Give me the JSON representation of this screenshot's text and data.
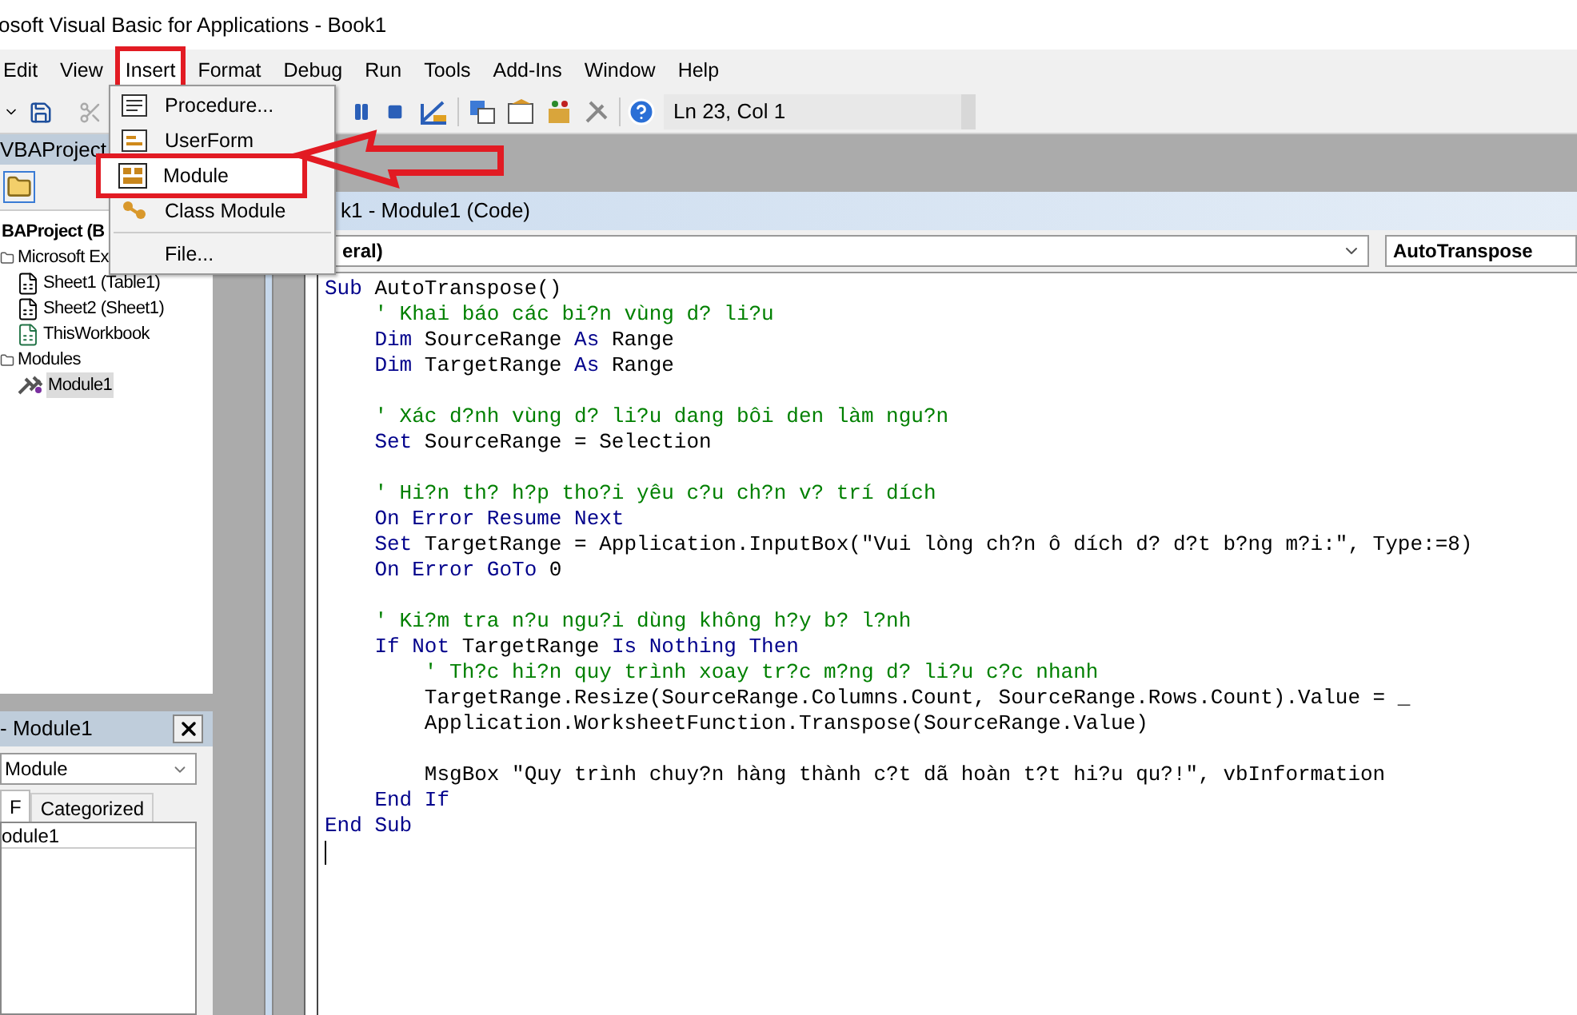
{
  "window": {
    "title": "osoft Visual Basic for Applications - Book1"
  },
  "menu_bar": [
    {
      "label": "Edit",
      "highlighted": false
    },
    {
      "label": "View",
      "highlighted": false
    },
    {
      "label": "Insert",
      "highlighted": true
    },
    {
      "label": "Format",
      "highlighted": false
    },
    {
      "label": "Debug",
      "highlighted": false
    },
    {
      "label": "Run",
      "highlighted": false
    },
    {
      "label": "Tools",
      "highlighted": false
    },
    {
      "label": "Add-Ins",
      "highlighted": false
    },
    {
      "label": "Window",
      "highlighted": false
    },
    {
      "label": "Help",
      "highlighted": false
    }
  ],
  "insert_menu": [
    {
      "label": "Procedure...",
      "kind": "procedure",
      "highlighted": false
    },
    {
      "label": "UserForm",
      "kind": "userform",
      "highlighted": false
    },
    {
      "label": "Module",
      "kind": "module",
      "highlighted": true
    },
    {
      "label": "Class Module",
      "kind": "class",
      "highlighted": false
    },
    {
      "label": "File...",
      "kind": "file",
      "highlighted": false
    }
  ],
  "toolbar": {
    "position": "Ln 23, Col 1"
  },
  "project_explorer": {
    "title": "VBAProject",
    "tree": [
      {
        "label": "BAProject (B",
        "kind": "project",
        "selected": false,
        "children": [
          {
            "label": "Microsoft Ex",
            "kind": "folder",
            "selected": false,
            "children": [
              {
                "label": "Sheet1 (Table1)",
                "kind": "sheet",
                "selected": false
              },
              {
                "label": "Sheet2 (Sheet1)",
                "kind": "sheet",
                "selected": false
              },
              {
                "label": "ThisWorkbook",
                "kind": "workbook",
                "selected": false
              }
            ]
          },
          {
            "label": "Modules",
            "kind": "folder",
            "selected": false,
            "children": [
              {
                "label": "Module1",
                "kind": "module",
                "selected": true
              }
            ]
          }
        ]
      }
    ]
  },
  "properties": {
    "title": "- Module1",
    "object": "Module",
    "tabs": [
      {
        "label": "F",
        "selected": true
      },
      {
        "label": "Categorized",
        "selected": false
      }
    ],
    "rows": [
      "odule1"
    ]
  },
  "code_window": {
    "title": "k1 - Module1 (Code)",
    "object": "eral)",
    "procedure": "AutoTranspose",
    "lines": [
      {
        "kind": "code",
        "segments": [
          {
            "t": "Sub",
            "kind": "keyword"
          },
          {
            "t": " AutoTranspose()",
            "kind": "plain"
          }
        ]
      },
      {
        "kind": "code",
        "segments": [
          {
            "t": "    ' Khai báo các bi?n vùng d? li?u",
            "kind": "comment"
          }
        ]
      },
      {
        "kind": "code",
        "segments": [
          {
            "t": "    Dim",
            "kind": "keyword"
          },
          {
            "t": " SourceRange ",
            "kind": "plain"
          },
          {
            "t": "As",
            "kind": "keyword"
          },
          {
            "t": " Range",
            "kind": "plain"
          }
        ]
      },
      {
        "kind": "code",
        "segments": [
          {
            "t": "    Dim",
            "kind": "keyword"
          },
          {
            "t": " TargetRange ",
            "kind": "plain"
          },
          {
            "t": "As",
            "kind": "keyword"
          },
          {
            "t": " Range",
            "kind": "plain"
          }
        ]
      },
      {
        "kind": "blank"
      },
      {
        "kind": "code",
        "segments": [
          {
            "t": "    ' Xác d?nh vùng d? li?u dang bôi den làm ngu?n",
            "kind": "comment"
          }
        ]
      },
      {
        "kind": "code",
        "segments": [
          {
            "t": "    Set",
            "kind": "keyword"
          },
          {
            "t": " SourceRange = Selection",
            "kind": "plain"
          }
        ]
      },
      {
        "kind": "blank"
      },
      {
        "kind": "code",
        "segments": [
          {
            "t": "    ' Hi?n th? h?p tho?i yêu c?u ch?n v? trí dích",
            "kind": "comment"
          }
        ]
      },
      {
        "kind": "code",
        "segments": [
          {
            "t": "    On Error Resume Next",
            "kind": "keyword"
          }
        ]
      },
      {
        "kind": "code",
        "segments": [
          {
            "t": "    Set",
            "kind": "keyword"
          },
          {
            "t": " TargetRange = Application.InputBox(\"Vui lòng ch?n ô dích d? d?t b?ng m?i:\", Type:=8)",
            "kind": "plain"
          }
        ]
      },
      {
        "kind": "code",
        "segments": [
          {
            "t": "    On Error GoTo",
            "kind": "keyword"
          },
          {
            "t": " 0",
            "kind": "plain"
          }
        ]
      },
      {
        "kind": "blank"
      },
      {
        "kind": "code",
        "segments": [
          {
            "t": "    ' Ki?m tra n?u ngu?i dùng không h?y b? l?nh",
            "kind": "comment"
          }
        ]
      },
      {
        "kind": "code",
        "segments": [
          {
            "t": "    If Not",
            "kind": "keyword"
          },
          {
            "t": " TargetRange ",
            "kind": "plain"
          },
          {
            "t": "Is Nothing Then",
            "kind": "keyword"
          }
        ]
      },
      {
        "kind": "code",
        "segments": [
          {
            "t": "        ' Th?c hi?n quy trình xoay tr?c m?ng d? li?u c?c nhanh",
            "kind": "comment"
          }
        ]
      },
      {
        "kind": "code",
        "segments": [
          {
            "t": "        TargetRange.Resize(SourceRange.Columns.Count, SourceRange.Rows.Count).Value = _",
            "kind": "plain"
          }
        ]
      },
      {
        "kind": "code",
        "segments": [
          {
            "t": "        Application.WorksheetFunction.Transpose(SourceRange.Value)",
            "kind": "plain"
          }
        ]
      },
      {
        "kind": "blank"
      },
      {
        "kind": "code",
        "segments": [
          {
            "t": "        MsgBox",
            "kind": "plain"
          },
          {
            "t": " \"Quy trình chuy?n hàng thành c?t dã hoàn t?t hi?u qu?!\", vbInformation",
            "kind": "plain"
          }
        ]
      },
      {
        "kind": "code",
        "segments": [
          {
            "t": "    End If",
            "kind": "keyword"
          }
        ]
      },
      {
        "kind": "code",
        "segments": [
          {
            "t": "End Sub",
            "kind": "keyword"
          }
        ]
      },
      {
        "kind": "cursor"
      }
    ]
  }
}
